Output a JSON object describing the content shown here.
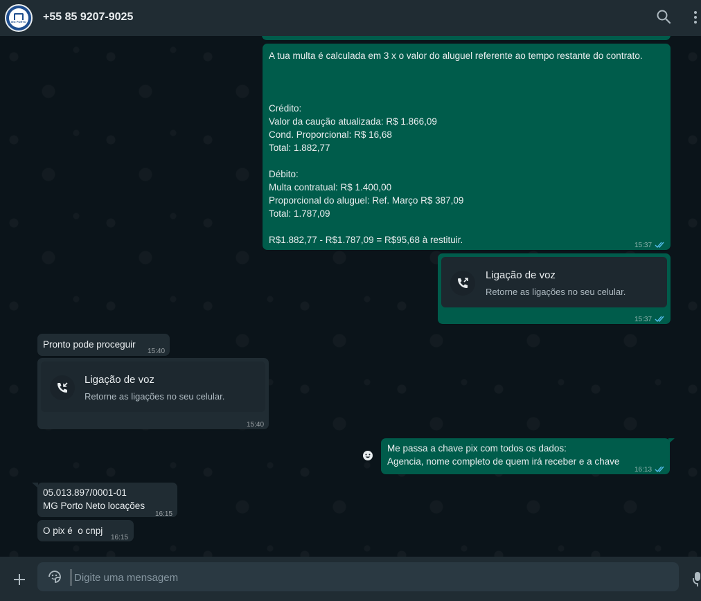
{
  "header": {
    "contact_name": "+55 85 9207-9025",
    "avatar_caption": "MG PORTO",
    "search_icon": "search-icon",
    "menu_icon": "menu-icon"
  },
  "messages": [
    {
      "type": "text",
      "direction": "outgoing",
      "lines": [
        "A tua multa é calculada em 3 x o valor do aluguel referente ao tempo restante do contrato.",
        "",
        "",
        "",
        "Crédito:",
        "Valor da caução atualizada: R$ 1.866,09",
        "Cond. Proporcional: R$ 16,68",
        "Total: 1.882,77",
        "",
        "Débito:",
        "Multa contratual: R$ 1.400,00",
        "Proporcional do aluguel: Ref. Março R$ 387,09",
        "Total: 1.787,09",
        "",
        "R$1.882,77 - R$1.787,09 = R$95,68 à restituir."
      ],
      "time": "15:37",
      "status": "read"
    },
    {
      "type": "call",
      "direction": "outgoing",
      "title": "Ligação de voz",
      "subtitle": "Retorne as ligações no seu celular.",
      "time": "15:37",
      "status": "read"
    },
    {
      "type": "text",
      "direction": "incoming",
      "lines": [
        "Pronto pode proceguir"
      ],
      "time": "15:40"
    },
    {
      "type": "call",
      "direction": "incoming",
      "title": "Ligação de voz",
      "subtitle": "Retorne as ligações no seu celular.",
      "time": "15:40"
    },
    {
      "type": "text",
      "direction": "outgoing",
      "lines": [
        "Me passa a chave pix com todos os dados:",
        "Agencia, nome completo de quem irá receber e a chave"
      ],
      "time": "16:13",
      "status": "read"
    },
    {
      "type": "text",
      "direction": "incoming",
      "lines": [
        "05.013.897/0001-01",
        "MG Porto Neto locações"
      ],
      "time": "16:15"
    },
    {
      "type": "text",
      "direction": "incoming",
      "lines": [
        "O pix é  o cnpj"
      ],
      "time": "16:15"
    }
  ],
  "composer": {
    "placeholder": "Digite uma mensagem",
    "attach_icon": "plus-icon",
    "emoji_icon": "sticker-icon",
    "mic_icon": "microphone-icon"
  },
  "colors": {
    "outgoing_bubble": "#005c4b",
    "incoming_bubble": "#202c33",
    "read_ticks": "#53bdeb",
    "background": "#0b141a"
  }
}
